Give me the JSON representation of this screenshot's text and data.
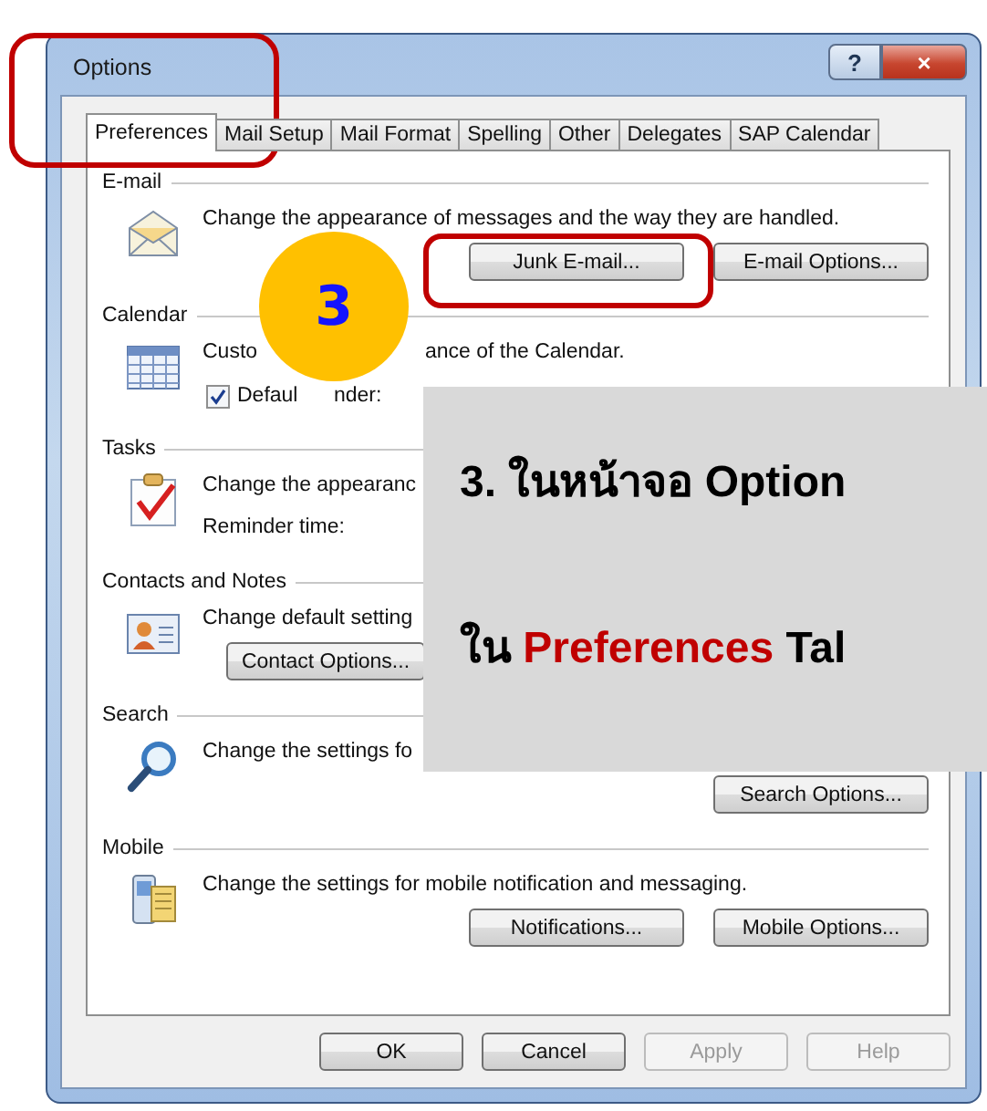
{
  "window": {
    "title": "Options",
    "help": "?",
    "close": "×"
  },
  "tabs": [
    {
      "label": "Preferences",
      "selected": true
    },
    {
      "label": "Mail Setup",
      "selected": false
    },
    {
      "label": "Mail Format",
      "selected": false
    },
    {
      "label": "Spelling",
      "selected": false
    },
    {
      "label": "Other",
      "selected": false
    },
    {
      "label": "Delegates",
      "selected": false
    },
    {
      "label": "SAP Calendar",
      "selected": false
    }
  ],
  "sections": [
    {
      "kind": "right-buttons",
      "title": "E-mail",
      "text_parts": [
        "Change the appearance of messages and the way they are handled."
      ],
      "buttons": [
        "Junk E-mail...",
        "E-mail Options..."
      ]
    },
    {
      "kind": "checkbox",
      "title": "Calendar",
      "text_parts": [
        "Custo",
        "ance of the Calendar."
      ],
      "checkbox": {
        "label_parts": [
          "Defaul",
          "nder:"
        ],
        "checked": true
      }
    },
    {
      "kind": "note",
      "title": "Tasks",
      "text_parts": [
        "Change the appearanc"
      ],
      "note": "Reminder time:"
    },
    {
      "kind": "left-buttons",
      "title": "Contacts and Notes",
      "text_parts": [
        "Change default setting"
      ],
      "buttons": [
        "Contact Options..."
      ]
    },
    {
      "kind": "right-buttons",
      "title": "Search",
      "text_parts": [
        "Change the settings fo"
      ],
      "buttons": [
        "Search Options..."
      ]
    },
    {
      "kind": "right-buttons",
      "title": "Mobile",
      "text_parts": [
        "Change the settings for mobile notification and messaging."
      ],
      "buttons": [
        "Notifications...",
        "Mobile Options..."
      ]
    }
  ],
  "footer_buttons": [
    {
      "label": "OK",
      "disabled": false
    },
    {
      "label": "Cancel",
      "disabled": false
    },
    {
      "label": "Apply",
      "disabled": true
    },
    {
      "label": "Help",
      "disabled": true
    }
  ],
  "annotation": {
    "step": "3",
    "line_1": "3. ในหน้าจอ Option",
    "line_2": {
      "before": "ใน ",
      "highlight": "Preferences",
      "after": " Tal"
    }
  }
}
